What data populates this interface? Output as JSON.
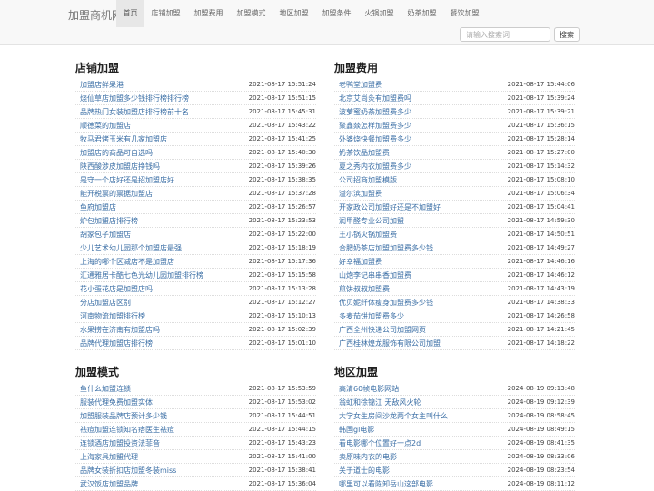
{
  "header": {
    "brand": "加盟商机网",
    "nav": [
      "首页",
      "店铺加盟",
      "加盟费用",
      "加盟模式",
      "地区加盟",
      "加盟条件",
      "火锅加盟",
      "奶茶加盟",
      "餐饮加盟"
    ],
    "active_nav": "首页",
    "search": {
      "placeholder": "请输入搜索词",
      "button": "搜索"
    }
  },
  "sections": [
    {
      "title": "店铺加盟",
      "items": [
        [
          "加盟店鲜果港",
          "2021-08-17 15:51:24"
        ],
        [
          "烧仙草店加盟多少钱排行榜排行榜",
          "2021-08-17 15:51:15"
        ],
        [
          "品牌热门女装加盟店排行榜前十名",
          "2021-08-17 15:45:31"
        ],
        [
          "顺德菜的加盟店",
          "2021-08-17 15:43:22"
        ],
        [
          "牧马君烤玉米有几家加盟店",
          "2021-08-17 15:41:25"
        ],
        [
          "加盟店的商品可自选吗",
          "2021-08-17 15:40:30"
        ],
        [
          "陕西酸涉皮加盟店挣钱吗",
          "2021-08-17 15:39:26"
        ],
        [
          "是守一个店好还是招加盟店好",
          "2021-08-17 15:38:35"
        ],
        [
          "能开税票的票据加盟店",
          "2021-08-17 15:37:28"
        ],
        [
          "鱼府加盟店",
          "2021-08-17 15:26:57"
        ],
        [
          "炉包加盟店排行榜",
          "2021-08-17 15:23:53"
        ],
        [
          "胡家包子加盟店",
          "2021-08-17 15:22:00"
        ],
        [
          "少儿艺术幼儿园那个加盟店最强",
          "2021-08-17 15:18:19"
        ],
        [
          "上海的哪个区减店不是加盟店",
          "2021-08-17 15:17:36"
        ],
        [
          "汇通雅居卡酷七色光幼儿园加盟排行榜",
          "2021-08-17 15:15:58"
        ],
        [
          "花小蛋花店是加盟店吗",
          "2021-08-17 15:13:28"
        ],
        [
          "分店加盟店区别",
          "2021-08-17 15:12:27"
        ],
        [
          "河南物流加盟排行榜",
          "2021-08-17 15:10:13"
        ],
        [
          "水果捞在济南有加盟店吗",
          "2021-08-17 15:02:39"
        ],
        [
          "品牌代理加盟店排行榜",
          "2021-08-17 15:01:10"
        ]
      ]
    },
    {
      "title": "加盟费用",
      "items": [
        [
          "老鸭堂加盟费",
          "2021-08-17 15:44:06"
        ],
        [
          "北京艾尚灸有加盟费吗",
          "2021-08-17 15:39:24"
        ],
        [
          "波萝蜜奶茶加盟费多少",
          "2021-08-17 15:39:21"
        ],
        [
          "聚鑫燚怎样加盟费多少",
          "2021-08-17 15:36:15"
        ],
        [
          "外婆烧快餐加盟费多少",
          "2021-08-17 15:28:14"
        ],
        [
          "奶茶饮品加盟费",
          "2021-08-17 15:27:00"
        ],
        [
          "夏之秀内衣加盟费多少",
          "2021-08-17 15:14:32"
        ],
        [
          "公司招商加盟模版",
          "2021-08-17 15:08:10"
        ],
        [
          "溢尔滨加盟费",
          "2021-08-17 15:06:34"
        ],
        [
          "开家政公司加盟好还是不加盟好",
          "2021-08-17 15:04:41"
        ],
        [
          "润甲醛专业公司加盟",
          "2021-08-17 14:59:30"
        ],
        [
          "王小锅火锅加盟费",
          "2021-08-17 14:50:51"
        ],
        [
          "合肥奶茶店加盟加盟费多少钱",
          "2021-08-17 14:49:27"
        ],
        [
          "好幸福加盟费",
          "2021-08-17 14:46:16"
        ],
        [
          "山炮李记串串香加盟费",
          "2021-08-17 14:46:12"
        ],
        [
          "煎饼叔叔加盟费",
          "2021-08-17 14:43:19"
        ],
        [
          "优贝妮纤体瘦身加盟费多少钱",
          "2021-08-17 14:38:33"
        ],
        [
          "多麦茄饼加盟费多少",
          "2021-08-17 14:26:58"
        ],
        [
          "广西全州快递公司加盟网页",
          "2021-08-17 14:21:45"
        ],
        [
          "广西桂林煌龙服饰有限公司加盟",
          "2021-08-17 14:18:22"
        ]
      ]
    },
    {
      "title": "加盟模式",
      "items": [
        [
          "鱼什么加盟连锁",
          "2021-08-17 15:53:59"
        ],
        [
          "服装代理免费加盟实体",
          "2021-08-17 15:53:02"
        ],
        [
          "加盟服装品牌店预计多少钱",
          "2021-08-17 15:44:51"
        ],
        [
          "祛痘加盟连锁知名痞医生祛痘",
          "2021-08-17 15:44:15"
        ],
        [
          "连锁酒店加盟投资法菲音",
          "2021-08-17 15:43:23"
        ],
        [
          "上海家具加盟代理",
          "2021-08-17 15:41:00"
        ],
        [
          "品牌女装折扣店加盟冬装miss",
          "2021-08-17 15:38:41"
        ],
        [
          "武汉饭店加盟品牌",
          "2021-08-17 15:36:04"
        ]
      ]
    },
    {
      "title": "地区加盟",
      "items": [
        [
          "高清60帧电影网站",
          "2024-08-19 09:13:48"
        ],
        [
          "翁虹和徐锦江 无敌风火轮",
          "2024-08-19 09:12:39"
        ],
        [
          "大学女生房间沙龙两个女主叫什么",
          "2024-08-19 08:58:45"
        ],
        [
          "韩国gl电影",
          "2024-08-19 08:49:15"
        ],
        [
          "看电影哪个位置好一点2d",
          "2024-08-19 08:41:35"
        ],
        [
          "卖原味内衣的电影",
          "2024-08-19 08:33:06"
        ],
        [
          "关于道士的电影",
          "2024-08-19 08:23:54"
        ],
        [
          "哪里可以看陈卸岳山这部电影",
          "2024-08-19 08:11:12"
        ]
      ]
    }
  ]
}
